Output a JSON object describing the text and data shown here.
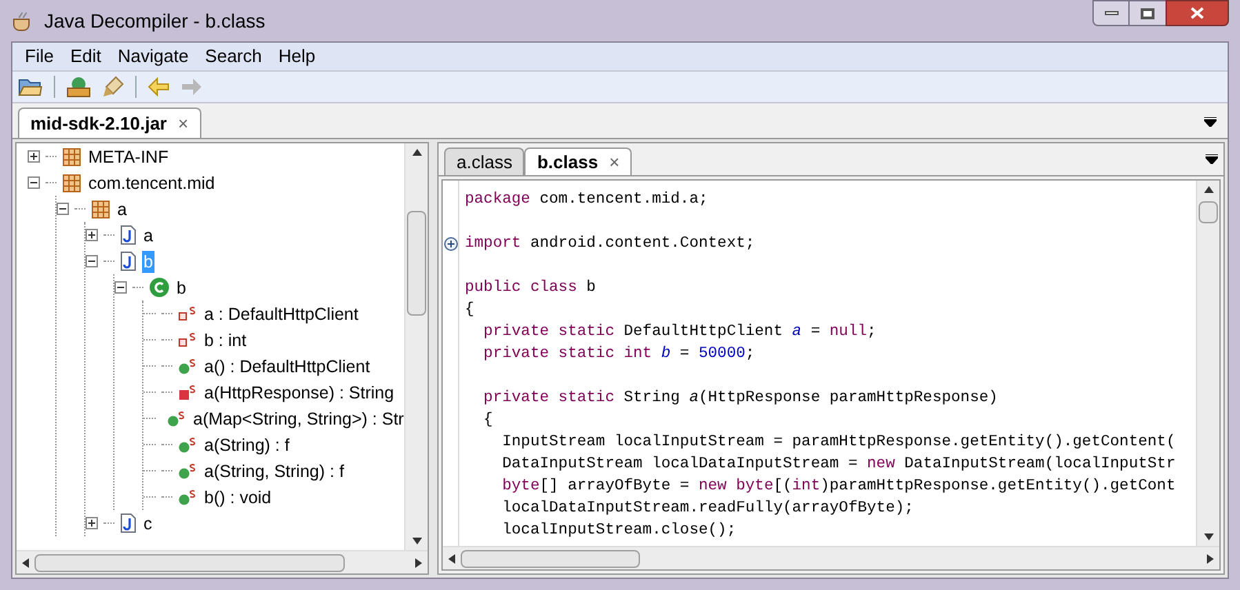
{
  "window": {
    "title": "Java Decompiler - b.class"
  },
  "menu": [
    "File",
    "Edit",
    "Navigate",
    "Search",
    "Help"
  ],
  "file_tab": {
    "label": "mid-sdk-2.10.jar",
    "close": "×"
  },
  "tree": [
    {
      "label": "META-INF",
      "kind": "package",
      "expanded": false,
      "selected": false
    },
    {
      "label": "com.tencent.mid",
      "kind": "package",
      "expanded": true,
      "selected": false,
      "children": [
        {
          "label": "a",
          "kind": "package",
          "expanded": true,
          "selected": false,
          "children": [
            {
              "label": "a",
              "kind": "file",
              "expanded": false,
              "selected": false
            },
            {
              "label": "b",
              "kind": "file",
              "expanded": true,
              "selected": true,
              "children": [
                {
                  "label": "b",
                  "kind": "class",
                  "expanded": true,
                  "selected": false,
                  "children": [
                    {
                      "label": "a : DefaultHttpClient",
                      "kind": "field",
                      "selected": false
                    },
                    {
                      "label": "b : int",
                      "kind": "field",
                      "selected": false
                    },
                    {
                      "label": "a() : DefaultHttpClient",
                      "kind": "method",
                      "selected": false
                    },
                    {
                      "label": "a(HttpResponse) : String",
                      "kind": "private-method",
                      "selected": false
                    },
                    {
                      "label": "a(Map<String, String>) : Str",
                      "kind": "method",
                      "selected": false
                    },
                    {
                      "label": "a(String) : f",
                      "kind": "method",
                      "selected": false
                    },
                    {
                      "label": "a(String, String) : f",
                      "kind": "method",
                      "selected": false
                    },
                    {
                      "label": "b() : void",
                      "kind": "method",
                      "selected": false
                    }
                  ]
                }
              ]
            },
            {
              "label": "c",
              "kind": "file",
              "expanded": false,
              "selected": false
            }
          ]
        }
      ]
    }
  ],
  "editor_tabs": [
    {
      "label": "a.class",
      "selected": false
    },
    {
      "label": "b.class",
      "selected": true,
      "close": "×"
    }
  ],
  "code": [
    {
      "segments": [
        {
          "text": "package",
          "kind": "keyword"
        },
        {
          "text": " com.tencent.mid.a;",
          "kind": "plain"
        }
      ]
    },
    {
      "gap_before": true,
      "folded": true,
      "segments": [
        {
          "text": "import",
          "kind": "keyword"
        },
        {
          "text": " android.content.Context;",
          "kind": "plain"
        }
      ]
    },
    {
      "gap_before": true,
      "segments": [
        {
          "text": "public class",
          "kind": "keyword"
        },
        {
          "text": " b",
          "kind": "plain"
        }
      ]
    },
    {
      "segments": [
        {
          "text": "{",
          "kind": "plain"
        }
      ]
    },
    {
      "segments": [
        {
          "text": "  private static",
          "kind": "keyword"
        },
        {
          "text": " DefaultHttpClient ",
          "kind": "plain"
        },
        {
          "text": "a",
          "kind": "field"
        },
        {
          "text": " = ",
          "kind": "plain"
        },
        {
          "text": "null",
          "kind": "keyword"
        },
        {
          "text": ";",
          "kind": "plain"
        }
      ]
    },
    {
      "segments": [
        {
          "text": "  private static int",
          "kind": "keyword"
        },
        {
          "text": " b",
          "kind": "field"
        },
        {
          "text": " = ",
          "kind": "plain"
        },
        {
          "text": "50000",
          "kind": "number"
        },
        {
          "text": ";",
          "kind": "plain"
        }
      ]
    },
    {
      "gap_before": true,
      "segments": [
        {
          "text": "  private static",
          "kind": "keyword"
        },
        {
          "text": " String ",
          "kind": "plain"
        },
        {
          "text": "a",
          "kind": "method"
        },
        {
          "text": "(HttpResponse paramHttpResponse)",
          "kind": "plain"
        }
      ]
    },
    {
      "segments": [
        {
          "text": "  {",
          "kind": "plain"
        }
      ]
    },
    {
      "segments": [
        {
          "text": "    InputStream localInputStream = paramHttpResponse.getEntity().getContent(",
          "kind": "plain"
        }
      ]
    },
    {
      "segments": [
        {
          "text": "    DataInputStream localDataInputStream = ",
          "kind": "plain"
        },
        {
          "text": "new",
          "kind": "keyword"
        },
        {
          "text": " DataInputStream(localInputStr",
          "kind": "plain"
        }
      ]
    },
    {
      "segments": [
        {
          "text": "    byte",
          "kind": "keyword"
        },
        {
          "text": "[] arrayOfByte = ",
          "kind": "plain"
        },
        {
          "text": "new byte",
          "kind": "keyword"
        },
        {
          "text": "[(",
          "kind": "plain"
        },
        {
          "text": "int",
          "kind": "keyword"
        },
        {
          "text": ")paramHttpResponse.getEntity().getCont",
          "kind": "plain"
        }
      ]
    },
    {
      "segments": [
        {
          "text": "    localDataInputStream.readFully(arrayOfByte);",
          "kind": "plain"
        }
      ]
    },
    {
      "segments": [
        {
          "text": "    localInputStream.close();",
          "kind": "plain"
        }
      ]
    }
  ]
}
